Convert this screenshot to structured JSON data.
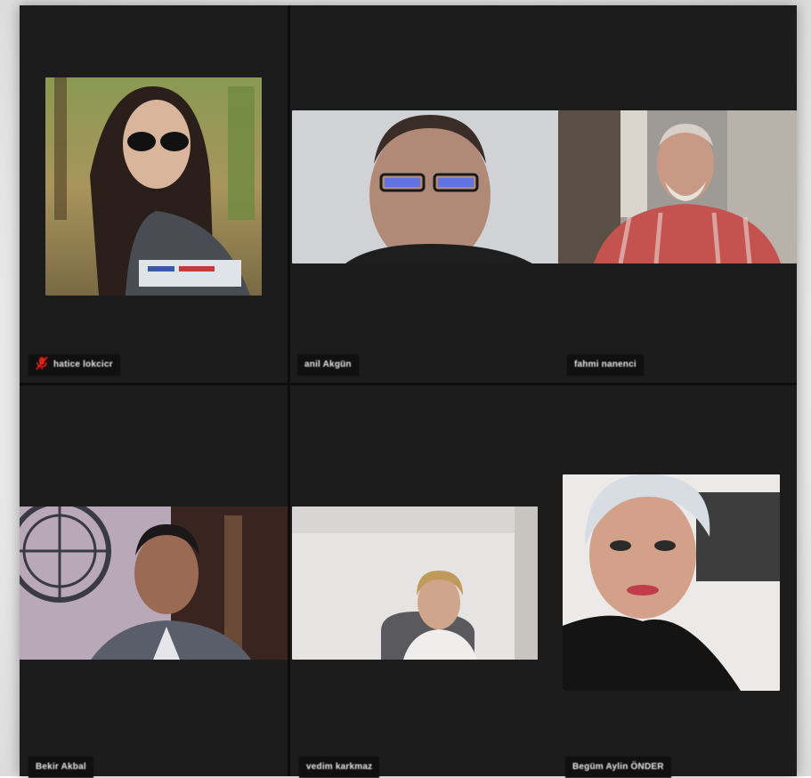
{
  "meeting": {
    "layout": "gallery-view",
    "participants": [
      {
        "name": "hatice lokcicr",
        "muted": true
      },
      {
        "name": "anil Akgün",
        "muted": false
      },
      {
        "name": "fahmi nanenci",
        "muted": false
      },
      {
        "name": "Bekir Akbal",
        "muted": false
      },
      {
        "name": "vedim karkmaz",
        "muted": false
      },
      {
        "name": "Begüm Aylin ÖNDER",
        "muted": false
      }
    ]
  },
  "colors": {
    "background": "#1c1c1c",
    "name_tag": "#101010",
    "muted_icon": "#e0201b"
  }
}
